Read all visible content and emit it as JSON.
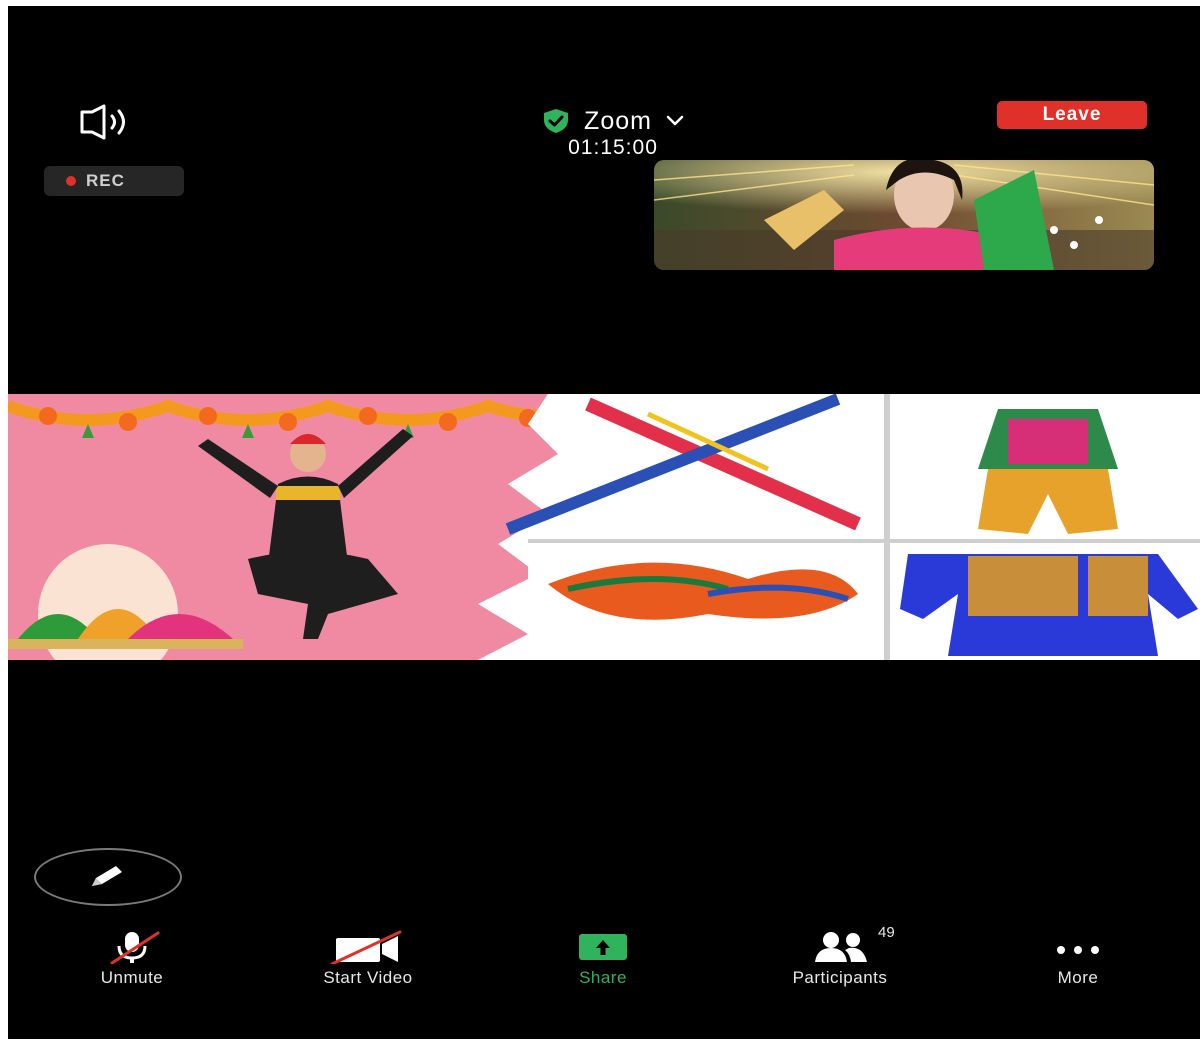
{
  "header": {
    "speaker_icon": "speaker-icon",
    "meeting_name": "Zoom",
    "security_icon": "shield-check-icon",
    "dropdown_icon": "chevron-down-icon",
    "timer": "01:15:00",
    "leave_label": "Leave"
  },
  "recording": {
    "label": "REC",
    "dot_color": "#e0302a"
  },
  "toolbar": {
    "annotate_icon": "pencil-icon",
    "items": [
      {
        "label": "Unmute",
        "icon": "microphone-muted-icon"
      },
      {
        "label": "Start Video",
        "icon": "video-off-icon"
      },
      {
        "label": "Share",
        "icon": "share-arrow-icon"
      },
      {
        "label": "Participants",
        "icon": "participants-icon",
        "count": "49"
      },
      {
        "label": "More",
        "icon": "more-dots-icon"
      }
    ]
  },
  "colors": {
    "background": "#000000",
    "leave_button": "#e0302a",
    "share_green": "#2fb35c",
    "security_green": "#2fb35c"
  }
}
